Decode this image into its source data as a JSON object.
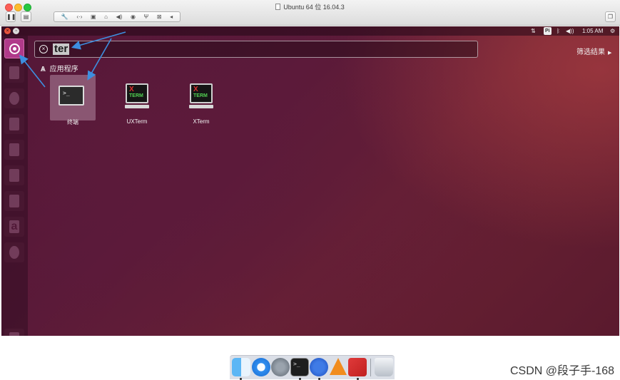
{
  "window": {
    "title": "Ubuntu 64 位 16.04.3"
  },
  "mac_toolbar": {
    "pause_icon": "pause-icon",
    "vm_icon": "vm-settings-icon",
    "tools": [
      "wrench-icon",
      "network-icon",
      "disk-icon",
      "lock-icon",
      "volume-icon",
      "camera-icon",
      "usb-icon",
      "share-icon",
      "chevron-left-icon"
    ]
  },
  "topbar": {
    "indicator_input": "Pi",
    "clock": "1:05 AM"
  },
  "search": {
    "query": "ter"
  },
  "filter": {
    "label": "筛选结果"
  },
  "category": {
    "label": "应用程序"
  },
  "results": [
    {
      "name": "终端",
      "icon": "terminal-icon"
    },
    {
      "name": "UXTerm",
      "icon": "xterm-icon"
    },
    {
      "name": "XTerm",
      "icon": "xterm-icon"
    }
  ],
  "lenses": [
    "home-lens-icon",
    "applications-lens-icon",
    "files-lens-icon",
    "video-lens-icon",
    "music-lens-icon",
    "photo-lens-icon"
  ],
  "dock": [
    "finder-icon",
    "safari-icon",
    "launchpad-icon",
    "terminal-icon",
    "vm-icon",
    "vlc-icon",
    "parallels-icon",
    "trash-icon"
  ],
  "watermark": "CSDN @段子手-168",
  "colors": {
    "accent": "#b03a8a",
    "desktop": "#5a1a38",
    "annotation_arrow": "#3d8fe0"
  }
}
